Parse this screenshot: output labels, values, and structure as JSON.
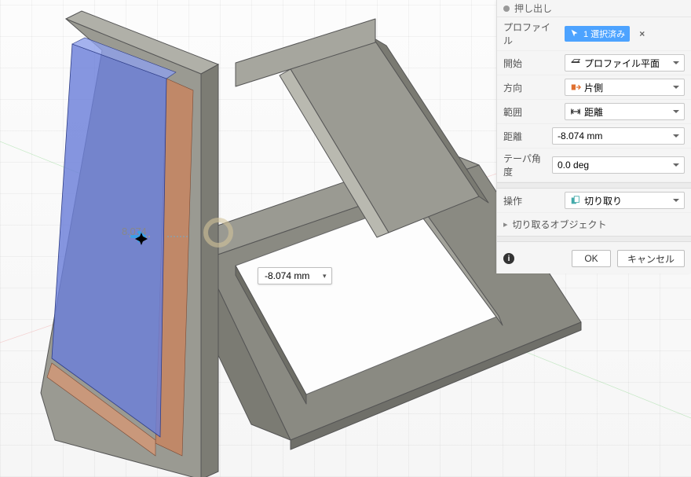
{
  "panel": {
    "title": "押し出し",
    "profile": {
      "label": "プロファイル",
      "chip_text": "1 選択済み"
    },
    "start": {
      "label": "開始",
      "value": "プロファイル平面"
    },
    "direction": {
      "label": "方向",
      "value": "片側"
    },
    "extent": {
      "label": "範囲",
      "value": "距離"
    },
    "distance": {
      "label": "距離",
      "value": "-8.074 mm"
    },
    "taper": {
      "label": "テーパ角度",
      "value": "0.0 deg"
    },
    "operation": {
      "label": "操作",
      "value": "切り取り"
    },
    "cut_objects": {
      "label": "切り取るオブジェクト"
    },
    "ok": "OK",
    "cancel": "キャンセル"
  },
  "viewport": {
    "drag_value": "8.074",
    "float_input": "-8.074 mm"
  },
  "colors": {
    "accent": "#4da3ff",
    "selection_face": "#6b7fd9",
    "cut_face": "#bf7a60",
    "body": "#8a8a85"
  }
}
